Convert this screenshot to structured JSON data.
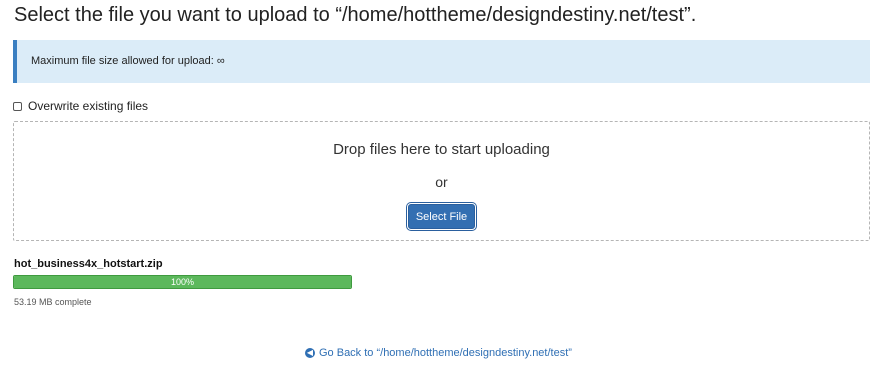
{
  "header": {
    "title": "Select the file you want to upload to “/home/hottheme/designdestiny.net/test”."
  },
  "alert": {
    "text": "Maximum file size allowed for upload: ∞"
  },
  "options": {
    "overwrite_label": "Overwrite existing files",
    "overwrite_checked": false
  },
  "dropzone": {
    "drop_text": "Drop files here to start uploading",
    "or_text": "or",
    "select_button_label": "Select File"
  },
  "upload": {
    "file_name": "hot_business4x_hotstart.zip",
    "progress_percent": 100,
    "progress_label": "100%",
    "status_text": "53.19 MB complete"
  },
  "footer": {
    "back_link_text": "Go Back to “/home/hottheme/designdestiny.net/test”",
    "back_icon": "arrow-left-circle-icon"
  },
  "colors": {
    "accent": "#336fb2",
    "alert_bg": "#dbecf8",
    "progress": "#5cb85c"
  }
}
